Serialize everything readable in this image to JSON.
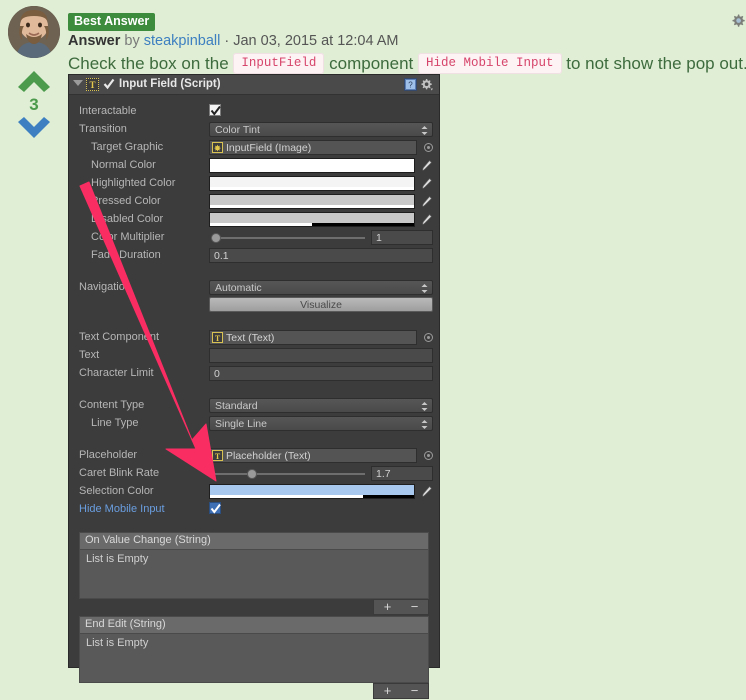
{
  "answer": {
    "badge": "Best Answer",
    "byline_prefix": "Answer",
    "byline_by": " by ",
    "author": "steakpinball",
    "separator": " · ",
    "timestamp": "Jan 03, 2015 at 12:04 AM",
    "body_part1": "Check the box on the ",
    "code1": "InputField",
    "body_part2": " component ",
    "code2": "Hide Mobile Input",
    "body_part3": " to not show the pop out."
  },
  "votes": {
    "count": "3",
    "up_icon": "chevron-up-icon",
    "down_icon": "chevron-down-icon",
    "up_color": "#4c9a4c",
    "down_color": "#3d7fc1"
  },
  "top_right": {
    "gear_icon": "gear-icon"
  },
  "inspector": {
    "component_title": "Input Field (Script)",
    "script_icon_letter": "T",
    "help_icon": "help-book-icon",
    "gear_icon": "gear-icon",
    "rows": {
      "interactable": {
        "label": "Interactable",
        "checked": true
      },
      "transition": {
        "label": "Transition",
        "value": "Color Tint"
      },
      "target_graphic": {
        "label": "Target Graphic",
        "value": "InputField (Image)",
        "icon_letter": "✸"
      },
      "normal_color": {
        "label": "Normal Color",
        "color": "#ffffff",
        "alpha": 100
      },
      "highlighted_color": {
        "label": "Highlighted Color",
        "color": "#f4f4f4",
        "alpha": 100
      },
      "pressed_color": {
        "label": "Pressed Color",
        "color": "#c8c8c8",
        "alpha": 100
      },
      "disabled_color": {
        "label": "Disabled Color",
        "color": "#c8c8c8",
        "alpha": 50
      },
      "color_multiplier": {
        "label": "Color Multiplier",
        "value": "1",
        "handle_pct": 0
      },
      "fade_duration": {
        "label": "Fade Duration",
        "value": "0.1"
      },
      "navigation": {
        "label": "Navigation",
        "value": "Automatic"
      },
      "visualize": {
        "label": "Visualize"
      },
      "text_component": {
        "label": "Text Component",
        "value": "Text (Text)",
        "icon_letter": "T"
      },
      "text": {
        "label": "Text",
        "value": ""
      },
      "character_limit": {
        "label": "Character Limit",
        "value": "0"
      },
      "content_type": {
        "label": "Content Type",
        "value": "Standard"
      },
      "line_type": {
        "label": "Line Type",
        "value": "Single Line"
      },
      "placeholder": {
        "label": "Placeholder",
        "value": "Placeholder (Text)",
        "icon_letter": "T"
      },
      "caret_blink_rate": {
        "label": "Caret Blink Rate",
        "value": "1.7",
        "handle_pct": 25
      },
      "selection_color": {
        "label": "Selection Color",
        "color": "#a8c8ee",
        "alpha": 75
      },
      "hide_mobile_input": {
        "label": "Hide Mobile Input",
        "checked": true,
        "highlighted": true
      }
    },
    "events": [
      {
        "header": "On Value Change (String)",
        "body": "List is Empty",
        "plus": "+",
        "minus": "−"
      },
      {
        "header": "End Edit (String)",
        "body": "List is Empty",
        "plus": "+",
        "minus": "−"
      }
    ]
  },
  "annotation": {
    "arrow_color": "#fa2d63",
    "points_to": "hide-mobile-input-checkbox"
  }
}
